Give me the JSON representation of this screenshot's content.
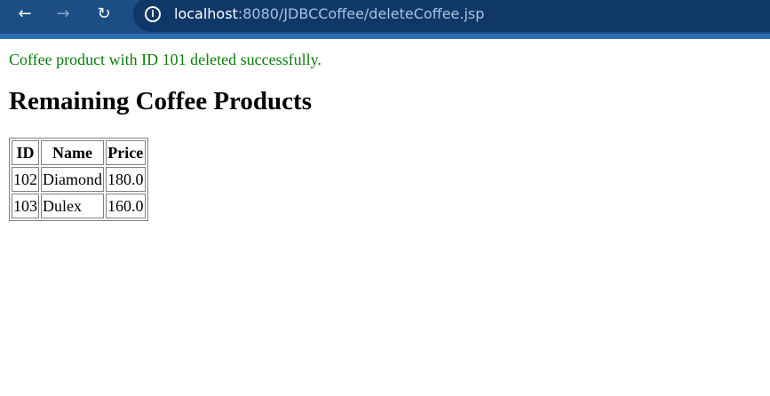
{
  "browser": {
    "back_icon": "arrow-left-icon",
    "forward_icon": "arrow-right-icon",
    "reload_icon": "reload-icon",
    "info_icon": "info-icon",
    "url_host": "localhost",
    "url_rest": ":8080/JDBCCoffee/deleteCoffee.jsp",
    "colors": {
      "toolbar": "#1c4e84",
      "address_bar": "#0f3868"
    }
  },
  "page": {
    "message": "Coffee product with ID 101 deleted successfully.",
    "message_color": "#0b7d0b",
    "heading": "Remaining Coffee Products",
    "table": {
      "headers": [
        "ID",
        "Name",
        "Price"
      ],
      "rows": [
        [
          "102",
          "Diamond",
          "180.0"
        ],
        [
          "103",
          "Dulex",
          "160.0"
        ]
      ]
    }
  }
}
